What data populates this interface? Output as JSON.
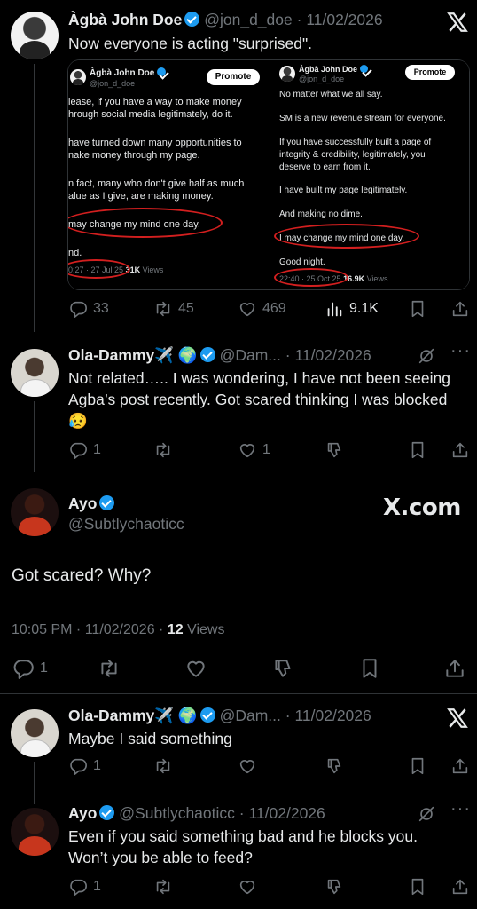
{
  "tweets": [
    {
      "name": "Àgbà John Doe",
      "handle": "@jon_d_doe",
      "sep": "·",
      "date": "11/02/2026",
      "text": "Now everyone is acting \"surprised\".",
      "stats": {
        "replies": "33",
        "retweets": "45",
        "likes": "469",
        "views": "9.1K"
      }
    },
    {
      "name": "Ola-Dammy✈️ 🌍",
      "handle": "@Dam...",
      "sep": "·",
      "date": "11/02/2026",
      "text": "Not related….. I was wondering, I have not been seeing Agba’s post recently. Got scared thinking I was blocked 😥",
      "stats": {
        "replies": "1",
        "likes": "1"
      }
    },
    {
      "name": "Ayo",
      "handle": "@Subtlychaoticc",
      "text": "Got scared? Why?",
      "time": "10:05 PM · 11/02/2026 · ",
      "views_count": "12",
      "views_label": " Views",
      "stats": {
        "replies": "1"
      }
    },
    {
      "name": "Ola-Dammy✈️ 🌍",
      "handle": "@Dam...",
      "sep": "·",
      "date": "11/02/2026",
      "text": "Maybe I said something",
      "stats": {
        "replies": "1"
      }
    },
    {
      "name": "Ayo",
      "handle": "@Subtlychaoticc",
      "sep": "·",
      "date": "11/02/2026",
      "text": "Even if you said something bad and he blocks you. Won’t you be able to feed?",
      "stats": {
        "replies": "1"
      }
    }
  ],
  "watermark": "X.com",
  "embeds": {
    "left": {
      "name": "Àgbà John Doe",
      "handle": "@jon_d_doe",
      "promote": "Promote",
      "lines": [
        "lease, if you have a way to make money",
        "hrough social media legitimately, do it.",
        "have turned down many opportunities to",
        "nake money through my page.",
        "n fact, many who don't give half as much",
        "alue as I give, are making money.",
        "may change my mind one day.",
        "nd."
      ],
      "time": "0:27 · 27 Jul 25",
      "views": "31K",
      "views_label": " Views"
    },
    "right": {
      "name": "Àgbà John Doe",
      "handle": "@jon_d_doe",
      "promote": "Promote",
      "lines": [
        "No matter what we all say.",
        "SM is a new revenue stream for everyone.",
        "If you have successfully built a page of",
        "integrity & credibility, legitimately, you",
        "deserve to earn from it.",
        "I have built my page legitimately.",
        "And making no dime.",
        "I may change my mind one day.",
        "Good night."
      ],
      "time": "22:40 · 25 Oct 25",
      "views": "16.9K",
      "views_label": " Views"
    }
  },
  "colors": {
    "accent": "#1d9bf0",
    "muted": "#71767b",
    "annotation": "#d31f1f",
    "background": "#000000"
  },
  "icons": [
    "x-logo-icon",
    "verified-badge-icon",
    "reply-icon",
    "retweet-icon",
    "like-icon",
    "views-icon",
    "bookmark-icon",
    "share-icon",
    "grok-icon",
    "more-icon",
    "dislike-icon"
  ]
}
